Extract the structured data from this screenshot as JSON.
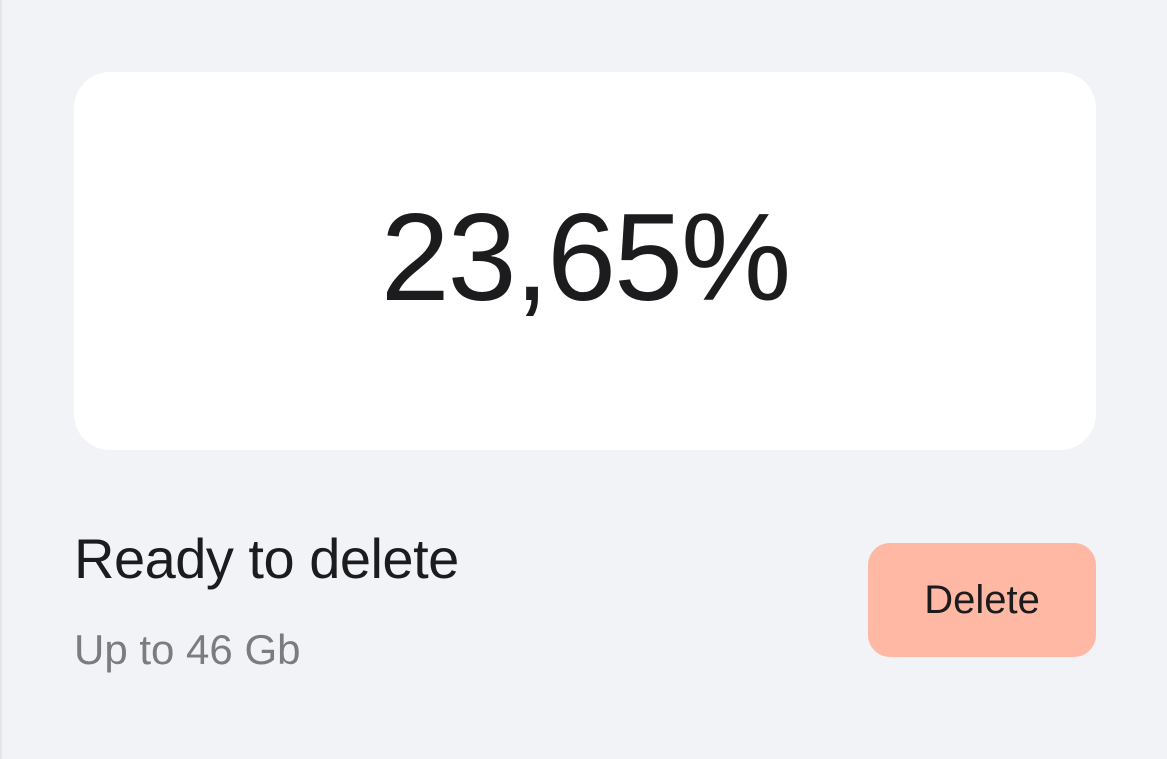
{
  "usage": {
    "percent_text": "23,65%",
    "percent_value": 23.65
  },
  "status": {
    "title": "Ready to delete",
    "subtitle": "Up to 46 Gb"
  },
  "actions": {
    "delete_label": "Delete"
  },
  "colors": {
    "background": "#f2f3f7",
    "card": "#ffffff",
    "button": "#ffb8a3",
    "text_primary": "#1c1c1e",
    "text_secondary": "#7b7b80"
  }
}
